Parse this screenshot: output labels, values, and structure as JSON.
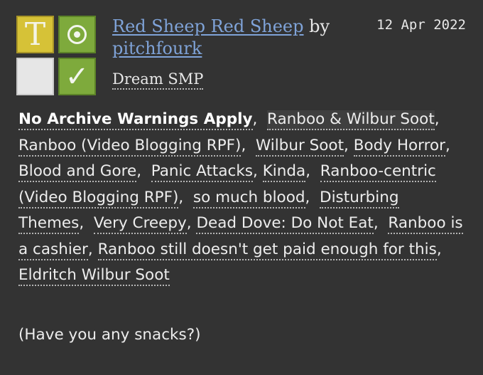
{
  "icons": {
    "rating": "T",
    "category": "circle-icon",
    "warning": "",
    "complete": "✓"
  },
  "work": {
    "title": "Red Sheep Red Sheep",
    "by": "by",
    "author": "pitchfourk",
    "date": "12 Apr 2022",
    "fandom": "Dream SMP"
  },
  "tags": [
    {
      "text": "No Archive Warnings Apply",
      "type": "warning"
    },
    {
      "text": "Ranboo & Wilbur Soot",
      "type": "relationship"
    },
    {
      "text": "Ranboo (Video Blogging RPF)",
      "type": "character"
    },
    {
      "text": "Wilbur Soot",
      "type": "character"
    },
    {
      "text": "Body Horror",
      "type": "freeform"
    },
    {
      "text": "Blood and Gore",
      "type": "freeform"
    },
    {
      "text": "Panic Attacks",
      "type": "freeform"
    },
    {
      "text": "Kinda",
      "type": "freeform"
    },
    {
      "text": "Ranboo-centric (Video Blogging RPF)",
      "type": "freeform"
    },
    {
      "text": "so much blood",
      "type": "freeform"
    },
    {
      "text": "Disturbing Themes",
      "type": "freeform"
    },
    {
      "text": "Very Creepy",
      "type": "freeform"
    },
    {
      "text": "Dead Dove: Do Not Eat",
      "type": "freeform"
    },
    {
      "text": "Ranboo is a cashier",
      "type": "freeform"
    },
    {
      "text": "Ranboo still doesn't get paid enough for this",
      "type": "freeform"
    },
    {
      "text": "Eldritch Wilbur Soot",
      "type": "freeform"
    }
  ],
  "summary": "(Have you any snacks?)"
}
